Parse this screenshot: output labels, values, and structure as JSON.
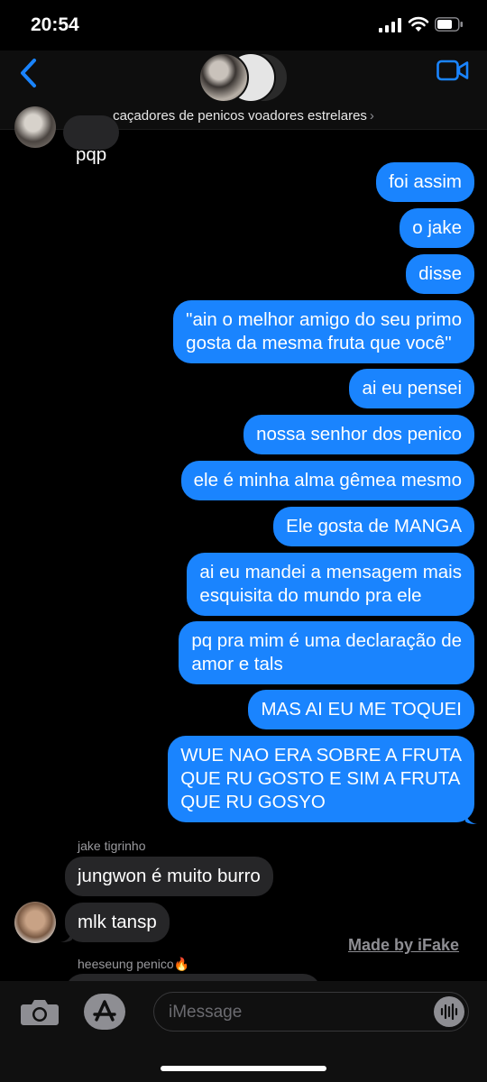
{
  "status_bar": {
    "time": "20:54"
  },
  "header": {
    "group_name": "caçadores de penicos voadores estrelares",
    "chevron": "›"
  },
  "messages": {
    "top_partial": "pqp",
    "out": [
      "foi assim",
      "o jake",
      "disse",
      "\"ain o melhor amigo do seu primo\ngosta da mesma fruta que você\"",
      "ai eu pensei",
      "nossa senhor dos penico",
      "ele é minha alma gêmea mesmo",
      "Ele gosta de MANGA",
      "ai eu mandei a mensagem mais\nesquisita do mundo pra ele",
      "pq pra mim é uma declaração de\namor e tals",
      "MAS AI EU ME TOQUEI",
      "WUE NAO ERA SOBRE A FRUTA\nQUE RU GOSTO E SIM A FRUTA\nQUE RU GOSYO"
    ],
    "sender_1": "jake tigrinho",
    "in_1": "jungwon é muito burro",
    "in_2": "mlk tansp",
    "sender_2": "heeseung penico🔥"
  },
  "watermark": "Made by iFake",
  "composer": {
    "placeholder": "iMessage"
  },
  "colors": {
    "outgoing": "#1a84fe",
    "incoming": "#262628",
    "background": "#000000"
  },
  "icons": [
    "back-chevron-icon",
    "video-call-icon",
    "camera-icon",
    "app-store-icon",
    "audio-waveform-icon"
  ]
}
